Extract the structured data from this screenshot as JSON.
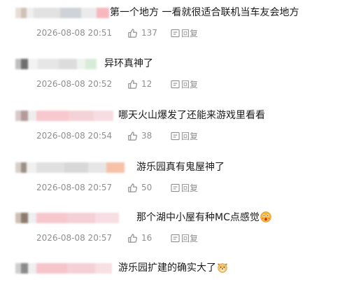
{
  "comments": [
    {
      "text": "第一个地方 一看就很适合联机当车友会地方",
      "time": "2026-08-08 20:51",
      "likes": "137",
      "reply_label": "回复",
      "emoji": ""
    },
    {
      "text": "异环真神了",
      "time": "2026-08-08 20:52",
      "likes": "12",
      "reply_label": "回复",
      "emoji": ""
    },
    {
      "text": "哪天火山爆发了还能来游戏里看看",
      "time": "2026-08-08 20:54",
      "likes": "38",
      "reply_label": "回复",
      "emoji": ""
    },
    {
      "text": "游乐园真有鬼屋神了",
      "time": "2026-08-08 20:57",
      "likes": "50",
      "reply_label": "回复",
      "emoji": ""
    },
    {
      "text": "那个湖中小屋有种MC点感觉",
      "time": "2026-08-08 20:57",
      "likes": "16",
      "reply_label": "回复",
      "emoji": "shocked-face-emoji"
    },
    {
      "text": "游乐园扩建的确实大了",
      "time": "2026-08-08 20:57",
      "likes": "",
      "reply_label": "",
      "emoji": "doge-emoji"
    }
  ],
  "colors": {
    "text": "#1a1a1a",
    "meta": "#8f8f8f",
    "blur_pink": "#f6c9cf",
    "blur_gray": "#d9d9d9"
  }
}
